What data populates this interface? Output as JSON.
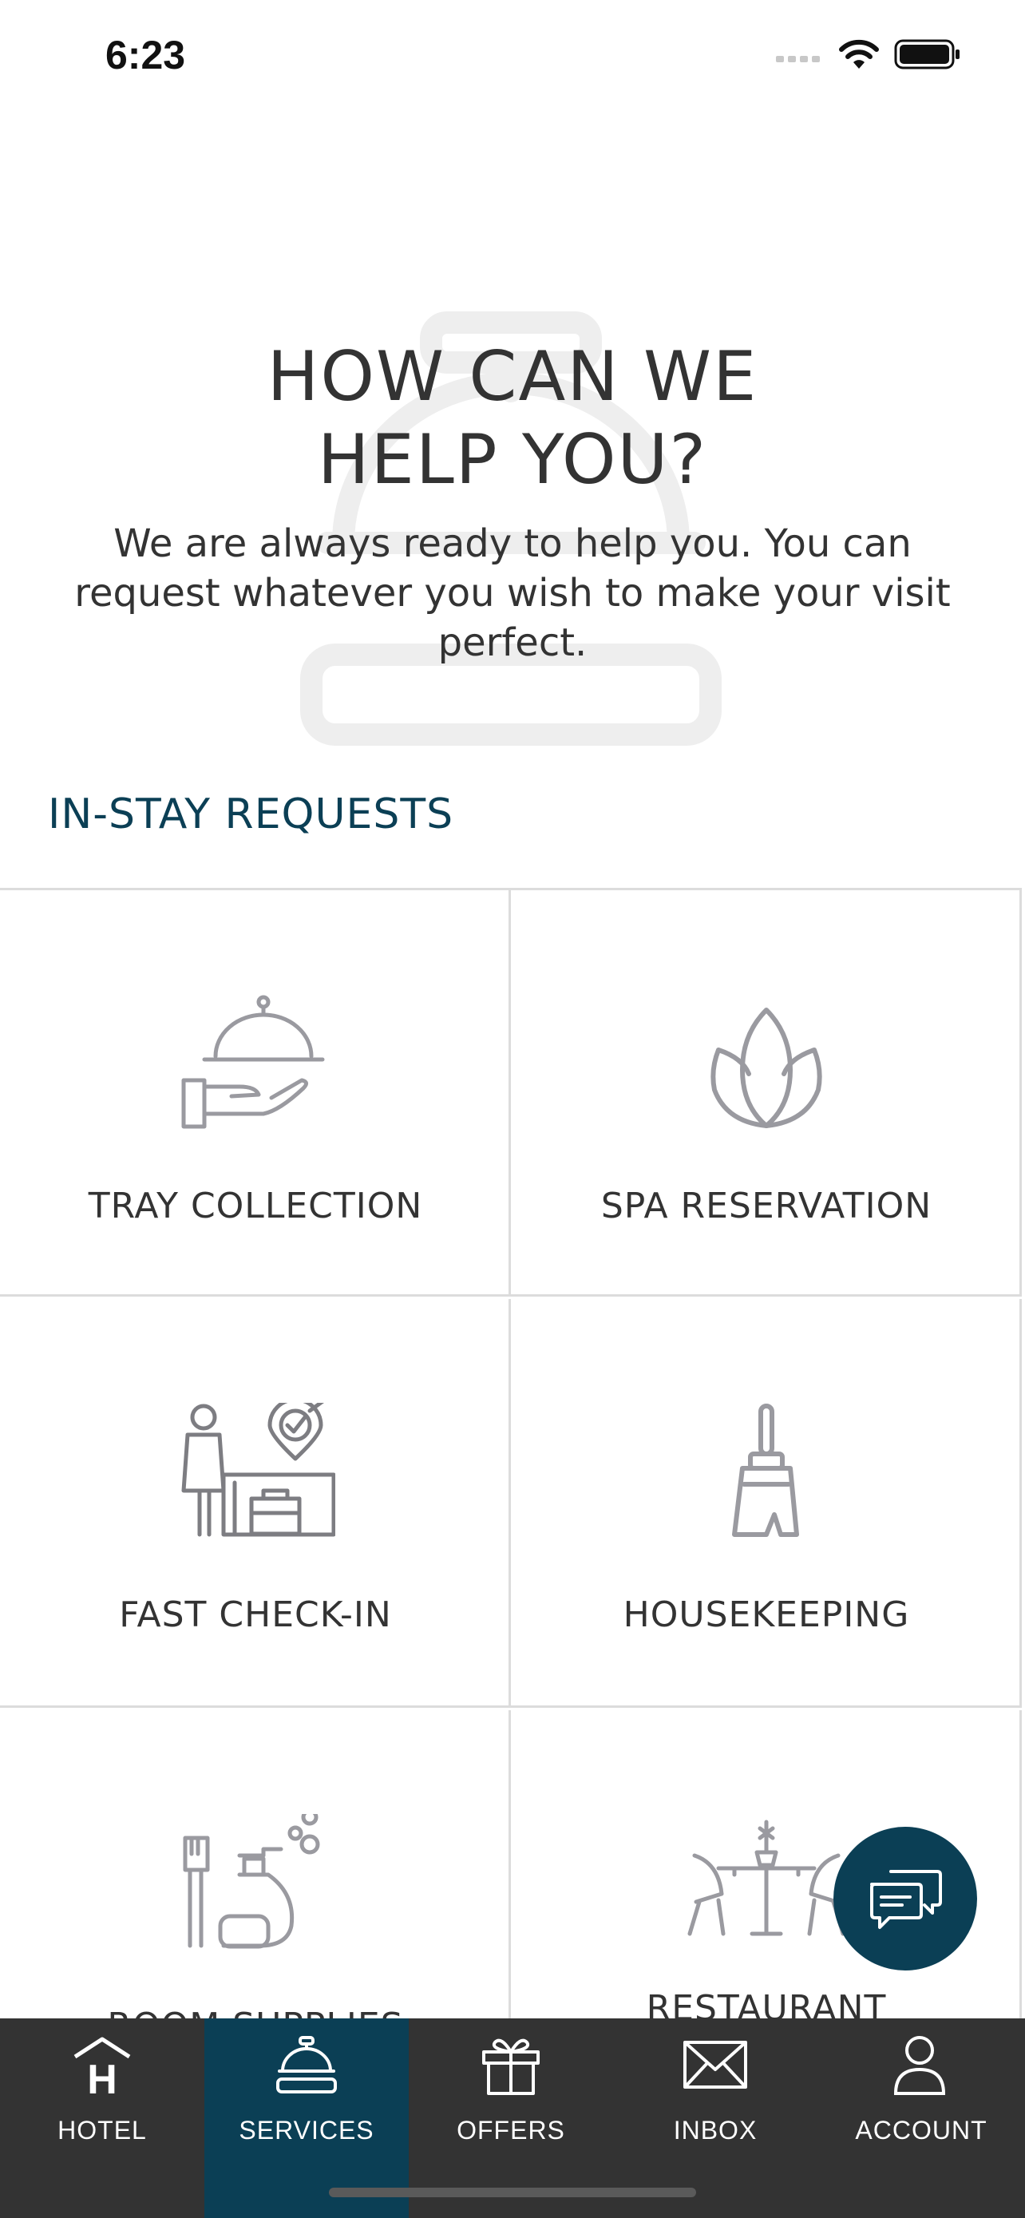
{
  "status_bar": {
    "time": "6:23"
  },
  "hero": {
    "title_line1": "HOW CAN WE",
    "title_line2": "HELP YOU?",
    "subtitle": "We are always ready to help you. You can request whatever you wish to make your visit perfect."
  },
  "section": {
    "title": "IN-STAY REQUESTS"
  },
  "services": [
    {
      "label": "TRAY COLLECTION",
      "icon": "tray-icon"
    },
    {
      "label": "SPA RESERVATION",
      "icon": "lotus-icon"
    },
    {
      "label": "FAST CHECK-IN",
      "icon": "checkin-icon"
    },
    {
      "label": "HOUSEKEEPING",
      "icon": "broom-icon"
    },
    {
      "label": "ROOM SUPPLIES",
      "icon": "supplies-icon"
    },
    {
      "label": "RESTAURANT",
      "icon": "restaurant-icon"
    }
  ],
  "tabbar": {
    "tabs": [
      {
        "label": "HOTEL",
        "icon": "hotel-icon"
      },
      {
        "label": "SERVICES",
        "icon": "bell-icon",
        "active": true
      },
      {
        "label": "OFFERS",
        "icon": "gift-icon"
      },
      {
        "label": "INBOX",
        "icon": "mail-icon"
      },
      {
        "label": "ACCOUNT",
        "icon": "user-icon"
      }
    ]
  },
  "colors": {
    "accent": "#0b3f55",
    "tabbar": "#333333",
    "icon_gray": "#9a9aa0"
  }
}
